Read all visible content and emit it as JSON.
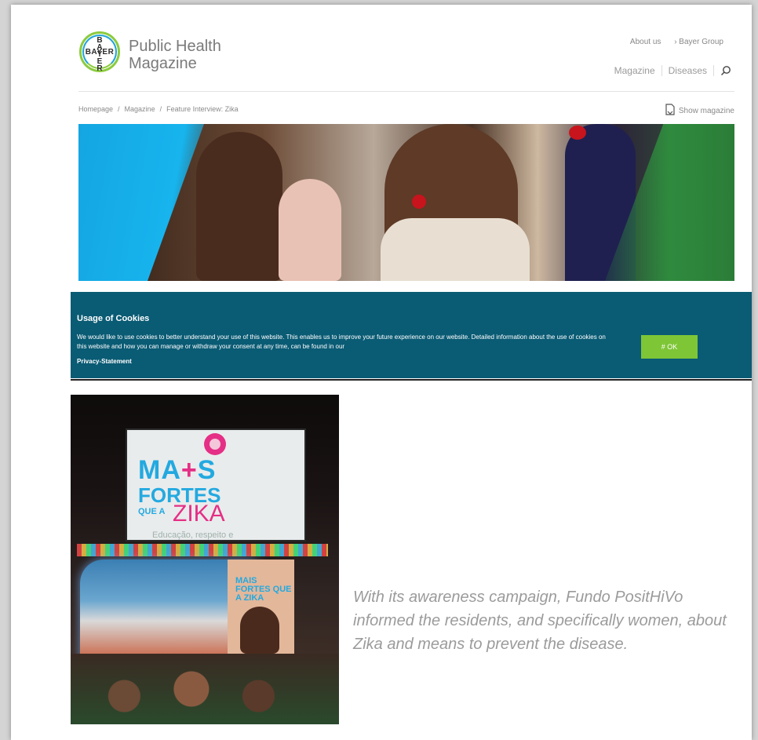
{
  "header": {
    "logo_vertical": "BAYER",
    "logo_horizontal": "BAYER",
    "brand_line1": "Public Health",
    "brand_line2": "Magazine",
    "top_links": [
      "About us",
      "› Bayer Group"
    ],
    "nav": [
      "Magazine",
      "Diseases"
    ]
  },
  "breadcrumb": {
    "items": [
      "Homepage",
      "Magazine",
      "Feature Interview: Zika"
    ],
    "separator": "/"
  },
  "show_magazine": "Show magazine",
  "cookie_banner": {
    "title": "Usage of Cookies",
    "text": "We would like to use cookies to better understand your use of this website. This enables us to improve your future experience on our website. Detailed information about the use of cookies on this website and how you can manage or withdraw your consent at any time, can be found in our",
    "link": "Privacy-Statement",
    "ok_label": "# OK",
    "background": "#0a5b74",
    "button_color": "#7ec636"
  },
  "photo": {
    "billboard_line1_a": "MA",
    "billboard_line1_b": "+",
    "billboard_line1_c": "S",
    "billboard_line2": "FORTES",
    "billboard_line3": "QUE A",
    "billboard_line4": "ZIKA",
    "billboard_line5": "Educação, respeito e",
    "poster_text": "MAIS FORTES QUE A ZIKA"
  },
  "caption": "With its awareness campaign, Fundo PositHiVo informed the residents, and specifically women, about Zika and means to prevent the disease."
}
